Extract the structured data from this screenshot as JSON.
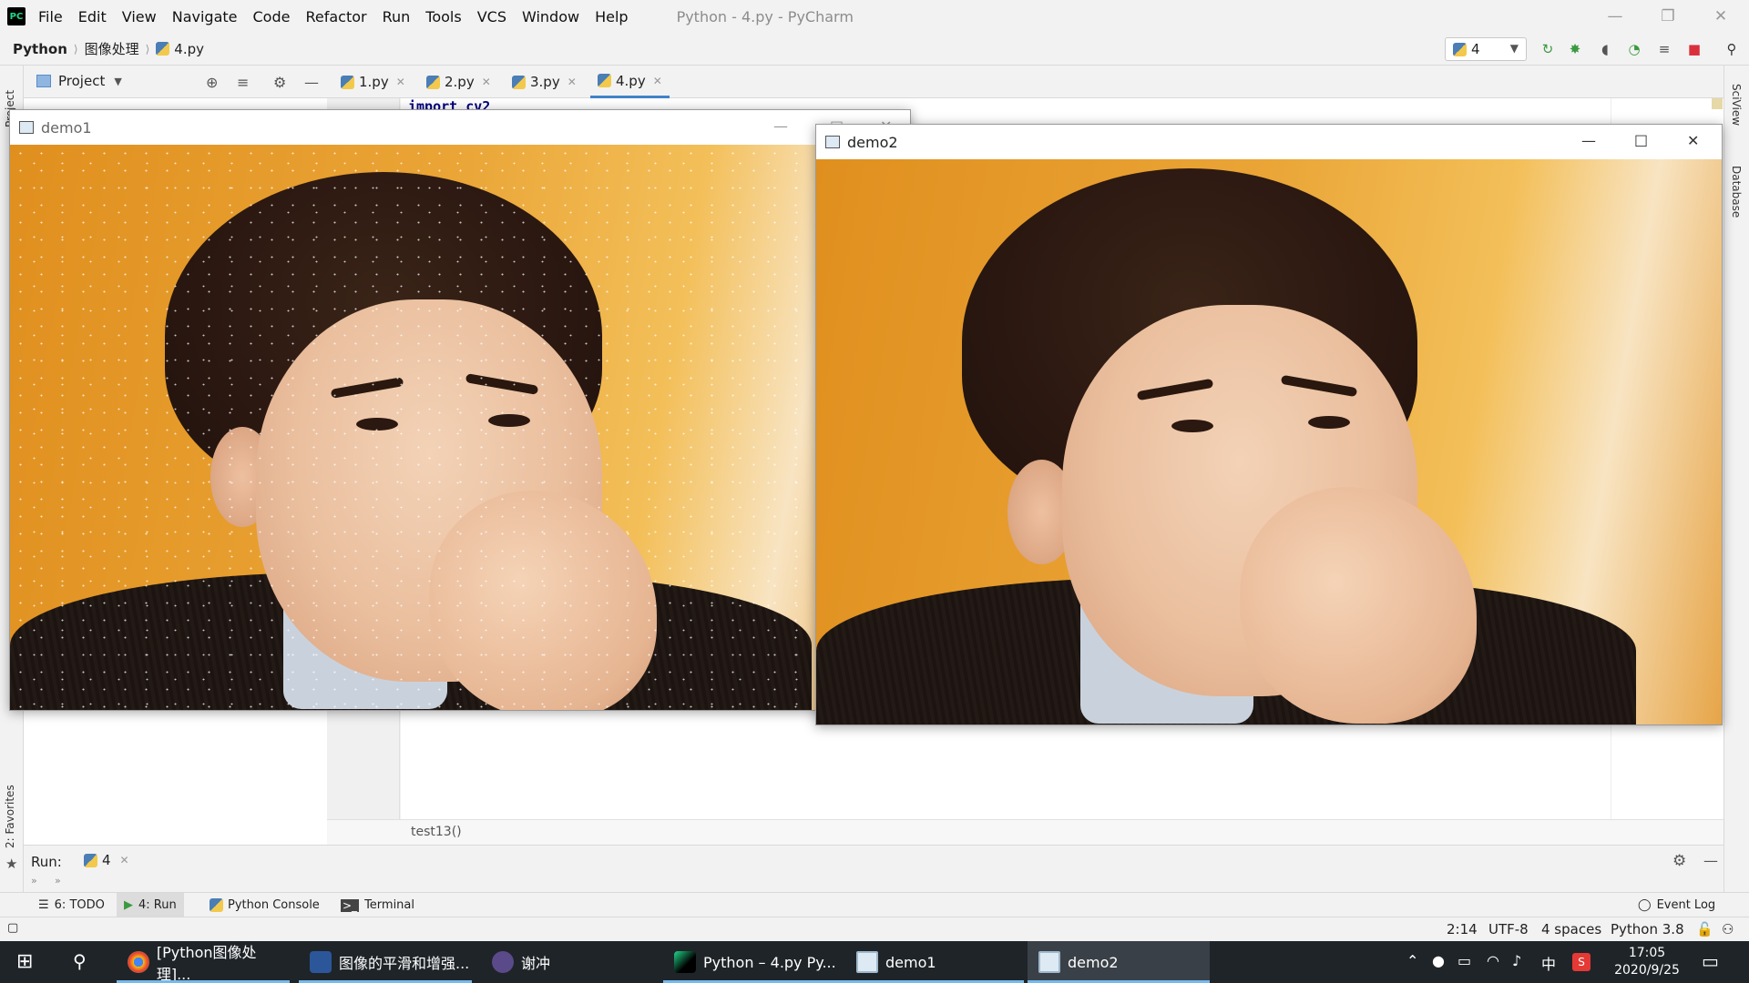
{
  "menubar": {
    "logo": "PC",
    "items": [
      "File",
      "Edit",
      "View",
      "Navigate",
      "Code",
      "Refactor",
      "Run",
      "Tools",
      "VCS",
      "Window",
      "Help"
    ],
    "title": "Python - 4.py - PyCharm"
  },
  "navbar": {
    "crumbs": [
      "Python",
      "图像处理",
      "4.py"
    ],
    "run_config": "4"
  },
  "tool_header": {
    "project_label": "Project",
    "tabs": [
      "1.py",
      "2.py",
      "3.py",
      "4.py"
    ],
    "active_tab": "4.py"
  },
  "editor": {
    "code_visible": "import cv2",
    "function_breadcrumb": "test13()"
  },
  "left_stripe": {
    "project": "Project",
    "favorites": "2: Favorites"
  },
  "right_stripe": {
    "sciview": "SciView",
    "database": "Database"
  },
  "run_panel": {
    "label": "Run:",
    "tab": "4"
  },
  "bottom_tools": {
    "todo": "6: TODO",
    "run": "4: Run",
    "console": "Python Console",
    "terminal": "Terminal",
    "event_log": "Event Log"
  },
  "status": {
    "position": "2:14",
    "encoding": "UTF-8",
    "indent": "4 spaces",
    "interpreter": "Python 3.8"
  },
  "windows": {
    "demo1": {
      "title": "demo1"
    },
    "demo2": {
      "title": "demo2"
    }
  },
  "taskbar": {
    "tasks": [
      "[Python图像处理]...",
      "图像的平滑和增强...",
      "谢冲",
      "Python – 4.py Py...",
      "demo1",
      "demo2"
    ],
    "time": "17:05",
    "date": "2020/9/25",
    "ime": "中"
  },
  "colors": {
    "accent": "#4083c9",
    "taskbar": "#1f2428",
    "run_green": "#3a9a40",
    "stop_red": "#d9303c"
  }
}
